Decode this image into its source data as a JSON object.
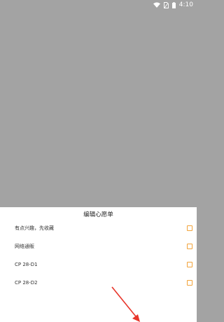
{
  "status_bar": {
    "time": "4:10",
    "icons": [
      "wifi-icon",
      "no-sim-icon",
      "battery-icon"
    ]
  },
  "sheet": {
    "title": "编辑心愿单",
    "items": [
      {
        "label": "有点兴趣，先收藏",
        "checked": false
      },
      {
        "label": "网络通販",
        "checked": false
      },
      {
        "label": "CP 28-D1",
        "checked": false
      },
      {
        "label": "CP 28-D2",
        "checked": false
      }
    ]
  },
  "colors": {
    "scrim": "#a3a3a3",
    "checkbox_border": "#f2a33a",
    "arrow": "#e8352a"
  }
}
